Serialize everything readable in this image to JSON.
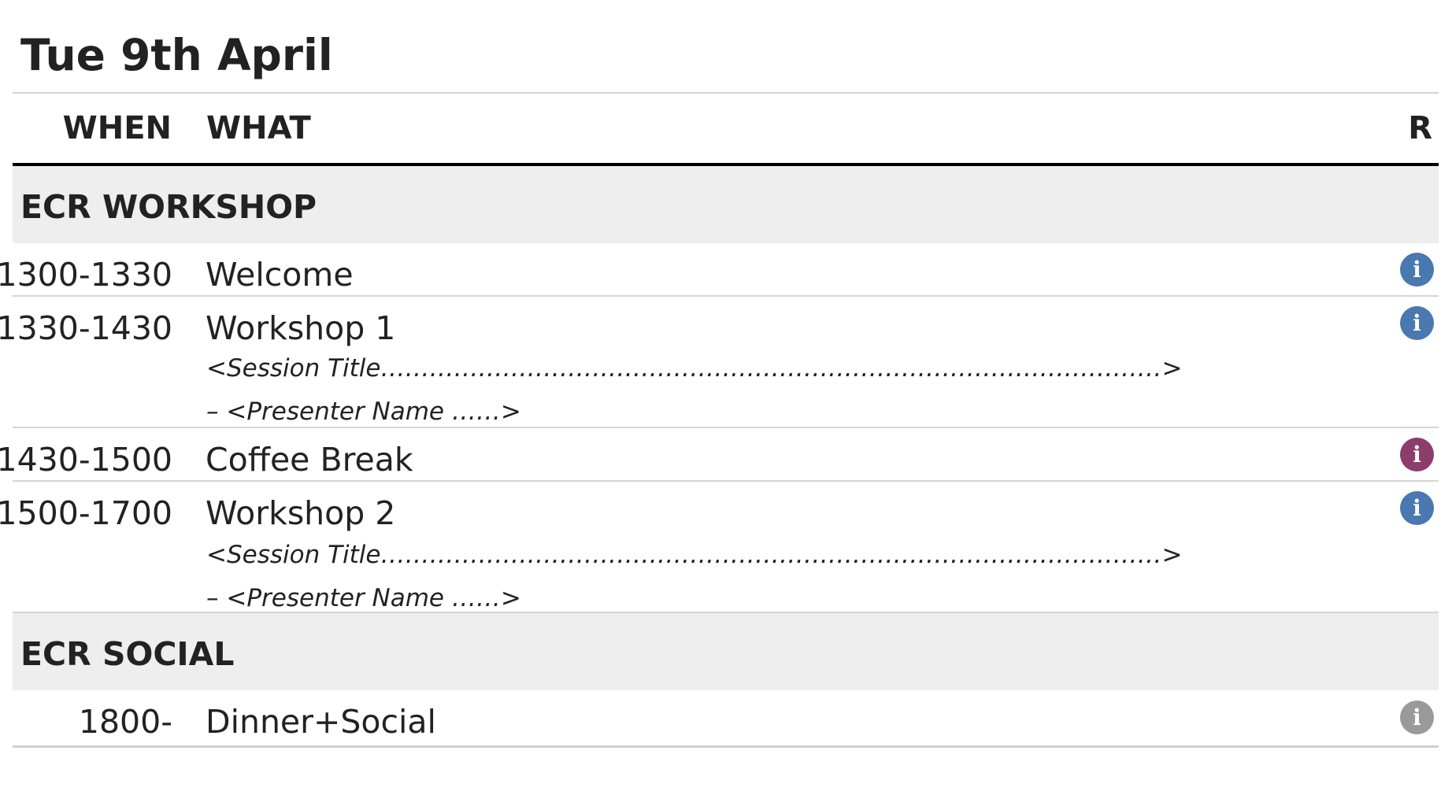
{
  "day": {
    "title": "Tue 9th April"
  },
  "header": {
    "when": "WHEN",
    "what": "WHAT",
    "r": "R"
  },
  "sections": [
    {
      "title": "ECR WORKSHOP",
      "rows": [
        {
          "when": "1300-1330",
          "what": "Welcome",
          "info_icon": "info-icon",
          "info_color": "#4a78b0"
        },
        {
          "when": "1330-1430",
          "what": "Workshop 1",
          "session_title": "<Session Title……………………………………………………………………………………>",
          "presenter": "– <Presenter Name ……>",
          "info_icon": "info-icon",
          "info_color": "#4a78b0"
        },
        {
          "when": "1430-1500",
          "what": "Coffee Break",
          "info_icon": "info-icon",
          "info_color": "#8c3d6c"
        },
        {
          "when": "1500-1700",
          "what": "Workshop 2",
          "session_title": "<Session Title……………………………………………………………………………………>",
          "presenter": "– <Presenter Name ……>",
          "info_icon": "info-icon",
          "info_color": "#4a78b0"
        }
      ]
    },
    {
      "title": "ECR SOCIAL",
      "rows": [
        {
          "when": "1800-",
          "what": "Dinner+Social",
          "info_icon": "info-icon",
          "info_color": "#9a9a9a"
        }
      ]
    }
  ],
  "info_glyph": "i"
}
